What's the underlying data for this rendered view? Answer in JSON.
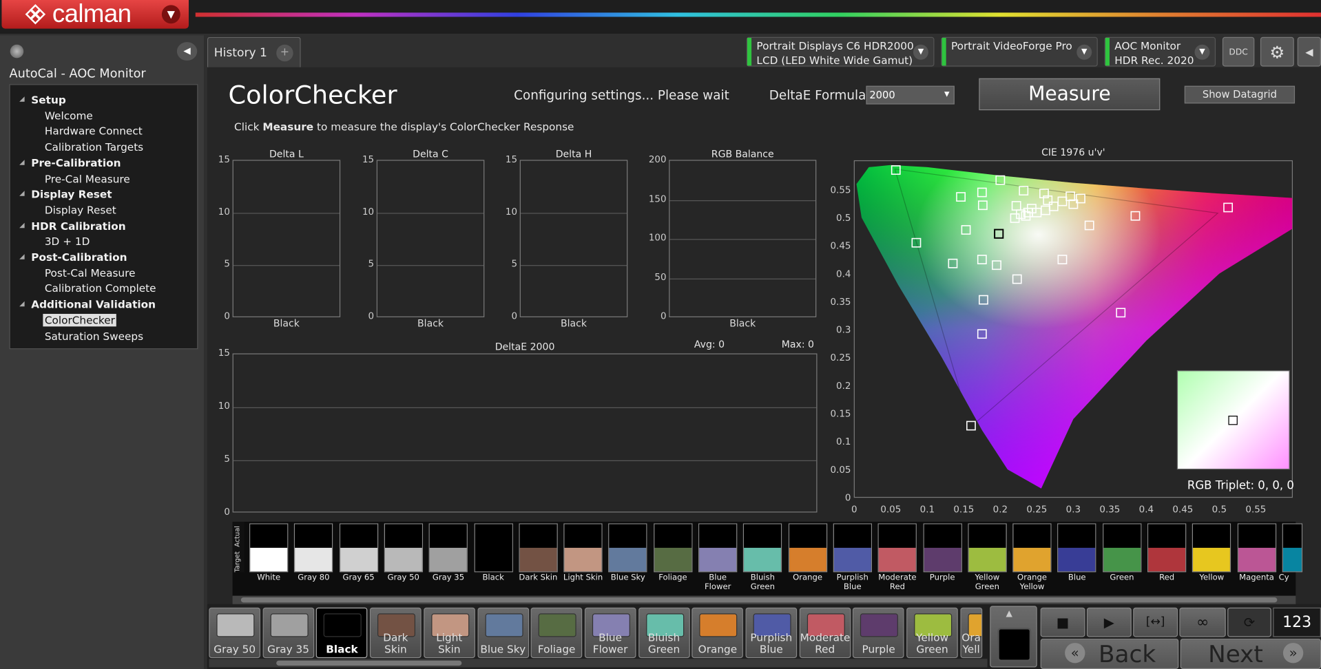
{
  "app": {
    "name": "calman"
  },
  "left": {
    "title": "AutoCal - AOC Monitor",
    "tree": [
      {
        "label": "Setup",
        "head": true
      },
      {
        "label": "Welcome"
      },
      {
        "label": "Hardware Connect"
      },
      {
        "label": "Calibration Targets"
      },
      {
        "label": "Pre-Calibration",
        "head": true
      },
      {
        "label": "Pre-Cal Measure"
      },
      {
        "label": "Display Reset",
        "head": true
      },
      {
        "label": "Display Reset"
      },
      {
        "label": "HDR Calibration",
        "head": true
      },
      {
        "label": "3D + 1D"
      },
      {
        "label": "Post-Calibration",
        "head": true
      },
      {
        "label": "Post-Cal Measure"
      },
      {
        "label": "Calibration Complete"
      },
      {
        "label": "Additional Validation",
        "head": true
      },
      {
        "label": "ColorChecker",
        "selected": true
      },
      {
        "label": "Saturation Sweeps"
      }
    ]
  },
  "tabs": {
    "history": "History 1",
    "add": "+"
  },
  "devices": {
    "d1": {
      "line1": "Portrait Displays C6 HDR2000",
      "line2": "LCD (LED White Wide Gamut)"
    },
    "d2": {
      "line1": "Portrait VideoForge Pro",
      "line2": ""
    },
    "d3": {
      "line1": "AOC Monitor",
      "line2": "HDR Rec. 2020"
    },
    "ddc": "DDC"
  },
  "header": {
    "title": "ColorChecker",
    "status": "Configuring settings... Please wait",
    "formula_label": "DeltaE Formula",
    "formula_value": "2000",
    "measure": "Measure",
    "datagrid": "Show Datagrid",
    "hint_pre": "Click ",
    "hint_bold": "Measure",
    "hint_post": " to measure the display's ColorChecker Response"
  },
  "small_charts": [
    {
      "title": "Delta L",
      "ticks": [
        "15",
        "10",
        "5",
        "0"
      ],
      "category": "Black"
    },
    {
      "title": "Delta C",
      "ticks": [
        "15",
        "10",
        "5",
        "0"
      ],
      "category": "Black"
    },
    {
      "title": "Delta H",
      "ticks": [
        "15",
        "10",
        "5",
        "0"
      ],
      "category": "Black"
    },
    {
      "title": "RGB Balance",
      "ticks": [
        "200",
        "150",
        "100",
        "50",
        "0"
      ],
      "category": "Black"
    }
  ],
  "deltae": {
    "title": "DeltaE 2000",
    "avg": "Avg: 0",
    "max": "Max: 0",
    "ticks": [
      "15",
      "10",
      "5",
      "0"
    ]
  },
  "chart_data": [
    {
      "type": "bar",
      "title": "Delta L",
      "categories": [
        "Black"
      ],
      "values": [
        0
      ],
      "ylim": [
        0,
        15
      ]
    },
    {
      "type": "bar",
      "title": "Delta C",
      "categories": [
        "Black"
      ],
      "values": [
        0
      ],
      "ylim": [
        0,
        15
      ]
    },
    {
      "type": "bar",
      "title": "Delta H",
      "categories": [
        "Black"
      ],
      "values": [
        0
      ],
      "ylim": [
        0,
        15
      ]
    },
    {
      "type": "bar",
      "title": "RGB Balance",
      "categories": [
        "Black"
      ],
      "values": [
        0
      ],
      "ylim": [
        0,
        200
      ]
    },
    {
      "type": "bar",
      "title": "DeltaE 2000",
      "categories": [],
      "values": [],
      "ylim": [
        0,
        15
      ]
    },
    {
      "type": "scatter",
      "title": "CIE 1976 u'v'",
      "xlim": [
        0,
        0.6
      ],
      "ylim": [
        0,
        0.6
      ],
      "xticks": [
        "0",
        "0.05",
        "0.1",
        "0.15",
        "0.2",
        "0.25",
        "0.3",
        "0.35",
        "0.4",
        "0.45",
        "0.5",
        "0.55"
      ],
      "yticks": [
        "0.55",
        "0.5",
        "0.45",
        "0.4",
        "0.35",
        "0.3",
        "0.25",
        "0.2",
        "0.15",
        "0.1",
        "0.05",
        "0"
      ],
      "targets": [
        [
          0.057,
          0.585
        ],
        [
          0.2,
          0.567
        ],
        [
          0.175,
          0.545
        ],
        [
          0.146,
          0.537
        ],
        [
          0.176,
          0.522
        ],
        [
          0.232,
          0.548
        ],
        [
          0.26,
          0.543
        ],
        [
          0.296,
          0.538
        ],
        [
          0.31,
          0.534
        ],
        [
          0.222,
          0.521
        ],
        [
          0.243,
          0.516
        ],
        [
          0.265,
          0.531
        ],
        [
          0.285,
          0.529
        ],
        [
          0.3,
          0.524
        ],
        [
          0.238,
          0.509
        ],
        [
          0.228,
          0.506
        ],
        [
          0.25,
          0.509
        ],
        [
          0.262,
          0.513
        ],
        [
          0.273,
          0.52
        ],
        [
          0.235,
          0.503
        ],
        [
          0.22,
          0.499
        ],
        [
          0.385,
          0.503
        ],
        [
          0.512,
          0.518
        ],
        [
          0.322,
          0.486
        ],
        [
          0.153,
          0.478
        ],
        [
          0.085,
          0.455
        ],
        [
          0.135,
          0.418
        ],
        [
          0.175,
          0.425
        ],
        [
          0.195,
          0.415
        ],
        [
          0.285,
          0.425
        ],
        [
          0.223,
          0.39
        ],
        [
          0.177,
          0.353
        ],
        [
          0.365,
          0.33
        ],
        [
          0.175,
          0.292
        ],
        [
          0.16,
          0.128
        ]
      ],
      "current": [
        0.198,
        0.471
      ],
      "legend": "RGB Triplet: 0, 0, 0"
    }
  ],
  "swatch_row_labels": {
    "actual": "Actual",
    "target": "Target"
  },
  "swatches": [
    {
      "name": "White",
      "color": "#ffffff"
    },
    {
      "name": "Gray 80",
      "color": "#e6e6e6"
    },
    {
      "name": "Gray 65",
      "color": "#d0d0d0"
    },
    {
      "name": "Gray 50",
      "color": "#b9b9b9"
    },
    {
      "name": "Gray 35",
      "color": "#a0a0a0"
    },
    {
      "name": "Black",
      "color": "#000000"
    },
    {
      "name": "Dark Skin",
      "color": "#735244"
    },
    {
      "name": "Light Skin",
      "color": "#c29682"
    },
    {
      "name": "Blue Sky",
      "color": "#627a9d"
    },
    {
      "name": "Foliage",
      "color": "#576c43"
    },
    {
      "name": "Blue Flower",
      "color": "#8580b1"
    },
    {
      "name": "Bluish Green",
      "color": "#67bdaa"
    },
    {
      "name": "Orange",
      "color": "#d67e2c"
    },
    {
      "name": "Purplish Blue",
      "color": "#505ba6"
    },
    {
      "name": "Moderate Red",
      "color": "#c15a63"
    },
    {
      "name": "Purple",
      "color": "#5e3c6c"
    },
    {
      "name": "Yellow Green",
      "color": "#9dbc40"
    },
    {
      "name": "Orange Yellow",
      "color": "#e0a32e"
    },
    {
      "name": "Blue",
      "color": "#383d96"
    },
    {
      "name": "Green",
      "color": "#469449"
    },
    {
      "name": "Red",
      "color": "#af363c"
    },
    {
      "name": "Yellow",
      "color": "#e7c71f"
    },
    {
      "name": "Magenta",
      "color": "#bb5695"
    },
    {
      "name": "Cy",
      "color": "#0885a1"
    }
  ],
  "tiles": [
    {
      "name": "Gray 50",
      "color": "#b9b9b9"
    },
    {
      "name": "Gray 35",
      "color": "#a0a0a0"
    },
    {
      "name": "Black",
      "color": "#000000",
      "sel": true
    },
    {
      "name": "Dark Skin",
      "color": "#735244"
    },
    {
      "name": "Light Skin",
      "color": "#c29682"
    },
    {
      "name": "Blue Sky",
      "color": "#627a9d"
    },
    {
      "name": "Foliage",
      "color": "#576c43"
    },
    {
      "name": "Blue Flower",
      "color": "#8580b1"
    },
    {
      "name": "Bluish Green",
      "color": "#67bdaa"
    },
    {
      "name": "Orange",
      "color": "#d67e2c"
    },
    {
      "name": "Purplish Blue",
      "color": "#505ba6"
    },
    {
      "name": "Moderate Red",
      "color": "#c15a63"
    },
    {
      "name": "Purple",
      "color": "#5e3c6c"
    },
    {
      "name": "Yellow Green",
      "color": "#9dbc40"
    },
    {
      "name": "Ora Yell",
      "color": "#e0a32e"
    }
  ],
  "controls": {
    "counter": "123",
    "back": "Back",
    "next": "Next"
  }
}
